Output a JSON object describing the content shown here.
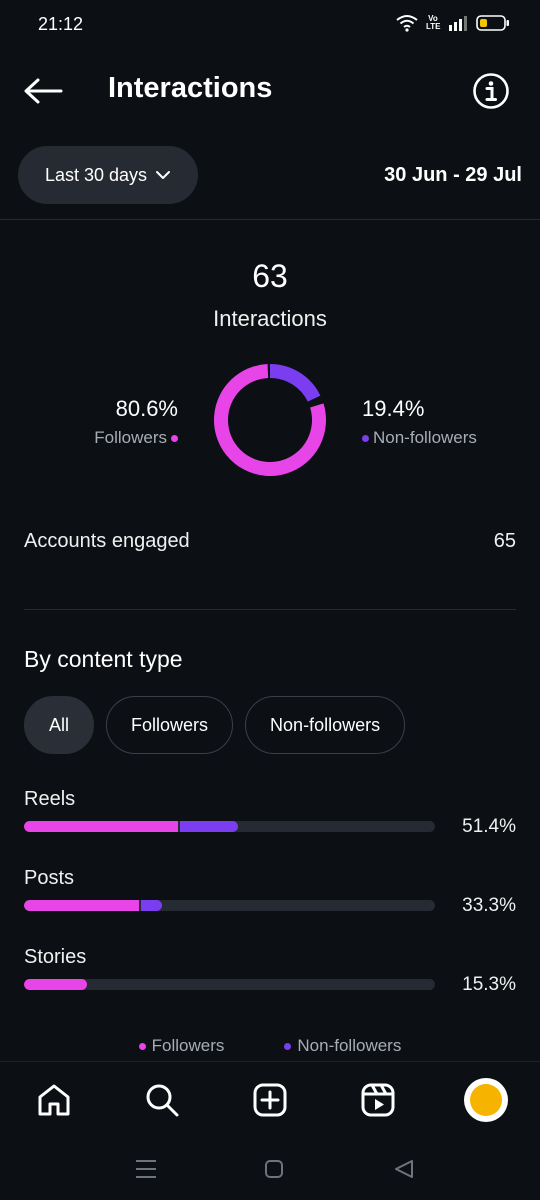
{
  "status_bar": {
    "time": "21:12",
    "volte": "Vo LTE"
  },
  "header": {
    "title": "Interactions"
  },
  "range": {
    "selector_label": "Last 30 days",
    "dates": "30 Jun - 29 Jul"
  },
  "summary": {
    "total": "63",
    "total_label": "Interactions",
    "followers_pct": "80.6%",
    "followers_label": "Followers",
    "nonfollowers_pct": "19.4%",
    "nonfollowers_label": "Non-followers",
    "followers_fraction": 0.806,
    "nonfollowers_fraction": 0.194
  },
  "engaged": {
    "label": "Accounts engaged",
    "value": "65"
  },
  "by_content": {
    "title": "By content type",
    "filters": [
      {
        "label": "All",
        "active": true
      },
      {
        "label": "Followers",
        "active": false
      },
      {
        "label": "Non-followers",
        "active": false
      }
    ],
    "rows": [
      {
        "label": "Reels",
        "pct": "51.4%",
        "followers_fraction": 0.375,
        "nonfollowers_fraction": 0.145
      },
      {
        "label": "Posts",
        "pct": "33.3%",
        "followers_fraction": 0.28,
        "nonfollowers_fraction": 0.055
      },
      {
        "label": "Stories",
        "pct": "15.3%",
        "followers_fraction": 0.153,
        "nonfollowers_fraction": 0
      }
    ],
    "legend": {
      "followers": "Followers",
      "nonfollowers": "Non-followers"
    }
  },
  "colors": {
    "followers": "#e845e8",
    "nonfollowers": "#7a3df0",
    "background": "#0c0f14"
  },
  "icons": {
    "nav": [
      "home-icon",
      "search-icon",
      "create-icon",
      "reels-icon",
      "profile-avatar"
    ],
    "system": [
      "menu-icon",
      "home-square-icon",
      "back-triangle-icon"
    ]
  }
}
